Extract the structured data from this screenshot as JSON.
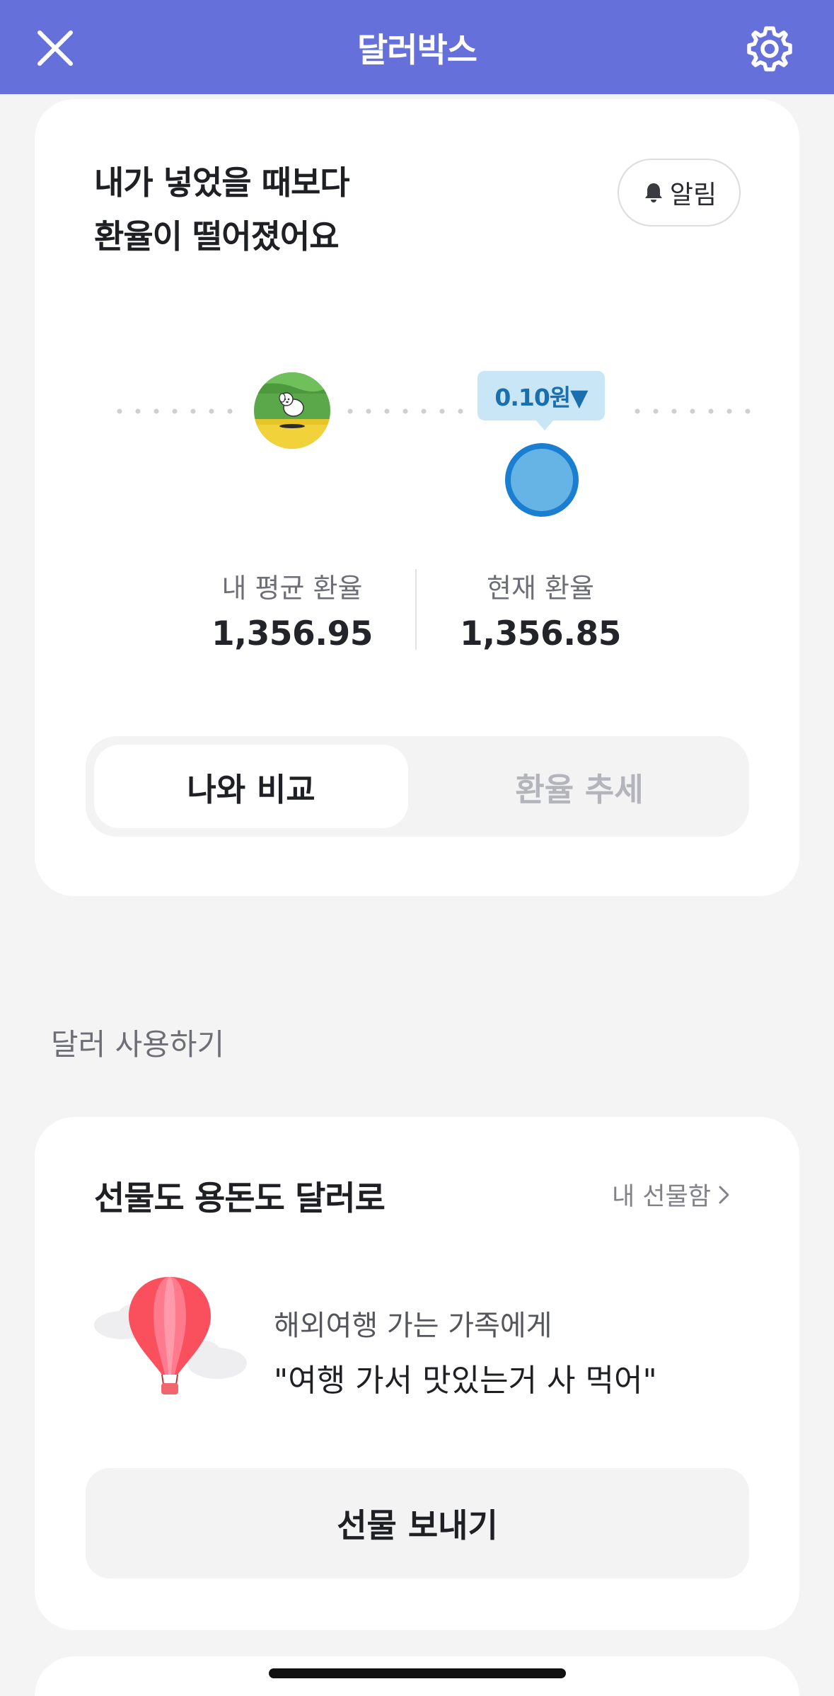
{
  "header": {
    "title": "달러박스"
  },
  "rate_card": {
    "headline_line1": "내가 넣었을 때보다",
    "headline_line2": "환율이 떨어졌어요",
    "alarm_label": "알림",
    "diff_badge": "0.10원▼",
    "my_avg_label": "내 평균 환율",
    "my_avg_value": "1,356.95",
    "current_label": "현재 환율",
    "current_value": "1,356.85",
    "segments": [
      "나와 비교",
      "환율 추세"
    ],
    "active_segment": "나와 비교"
  },
  "section": {
    "title": "달러 사용하기"
  },
  "gift_card": {
    "title": "선물도 용돈도 달러로",
    "link_label": "내 선물함",
    "desc_line1": "해외여행 가는 가족에게",
    "desc_line2": "\"여행 가서 맛있는거 사 먹어\"",
    "button_label": "선물 보내기"
  },
  "colors": {
    "header_bg": "#6670db",
    "badge_bg": "#c9e6f7",
    "badge_text": "#1a6fae",
    "current_dot": "#66b3e6",
    "current_dot_ring": "#1a7fd0"
  },
  "icons": [
    "close-icon",
    "gear-icon",
    "bell-icon",
    "chevron-right-icon",
    "balloon-illustration",
    "avatar-dog"
  ]
}
